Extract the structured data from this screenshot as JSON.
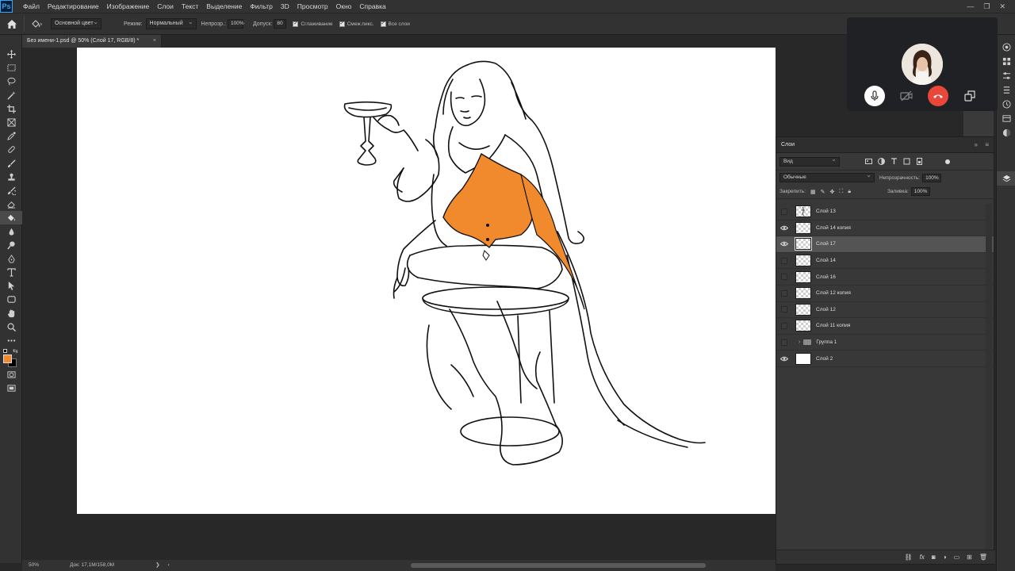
{
  "app": {
    "logo": "Ps"
  },
  "menu": [
    "Файл",
    "Редактирование",
    "Изображение",
    "Слои",
    "Текст",
    "Выделение",
    "Фильтр",
    "3D",
    "Просмотр",
    "Окно",
    "Справка"
  ],
  "window_controls": [
    "—",
    "❐",
    "✕"
  ],
  "options": {
    "source_select": "Основной цвет",
    "mode_label": "Режим:",
    "mode_value": "Нормальный",
    "opacity_label": "Непрозр.:",
    "opacity_value": "100%",
    "tolerance_label": "Допуск:",
    "tolerance_value": "80",
    "antialias_label": "Сглаживание",
    "contiguous_label": "Смеж.пикс.",
    "all_layers_label": "Все слои"
  },
  "document": {
    "tab_title": "Без имени-1.psd @ 50% (Слой 17, RGB/8) *",
    "close": "×"
  },
  "status": {
    "zoom": "50%",
    "doc_info": "Док: 17,1M/158,0M",
    "arrow": "❯",
    "left_arrow": "‹"
  },
  "colors": {
    "accent_orange": "#f08a2c",
    "canvas": "#ffffff",
    "panel": "#383838",
    "end_call": "#e8473a"
  },
  "layers_panel": {
    "title": "Слои",
    "filter_value": "Вид",
    "blend_mode": "Обычные",
    "opacity_label": "Непрозрачность:",
    "opacity_value": "100%",
    "lock_label": "Закрепить:",
    "fill_label": "Заливка:",
    "fill_value": "100%",
    "layers": [
      {
        "name": "Слой 13",
        "visible": false,
        "selected": false,
        "thumb": "sketch"
      },
      {
        "name": "Слой 14 копия",
        "visible": true,
        "selected": false,
        "thumb": "checker"
      },
      {
        "name": "Слой 17",
        "visible": true,
        "selected": true,
        "thumb": "checker"
      },
      {
        "name": "Слой 14",
        "visible": false,
        "selected": false,
        "thumb": "checker"
      },
      {
        "name": "Слой 16",
        "visible": false,
        "selected": false,
        "thumb": "checker"
      },
      {
        "name": "Слой 12 копия",
        "visible": false,
        "selected": false,
        "thumb": "checker"
      },
      {
        "name": "Слой 12",
        "visible": false,
        "selected": false,
        "thumb": "checker"
      },
      {
        "name": "Слой 11 копия",
        "visible": false,
        "selected": false,
        "thumb": "checker"
      },
      {
        "name": "Группа 1",
        "visible": false,
        "selected": false,
        "thumb": "folder"
      },
      {
        "name": "Слой 2",
        "visible": true,
        "selected": false,
        "thumb": "white"
      }
    ],
    "bottom_icons": [
      "link-icon",
      "fx-icon",
      "mask-icon",
      "adjustment-icon",
      "group-icon",
      "new-layer-icon",
      "trash-icon"
    ]
  },
  "video_call": {
    "buttons": [
      "microphone-icon",
      "camera-off-icon",
      "end-call-icon",
      "switch-window-icon"
    ]
  }
}
